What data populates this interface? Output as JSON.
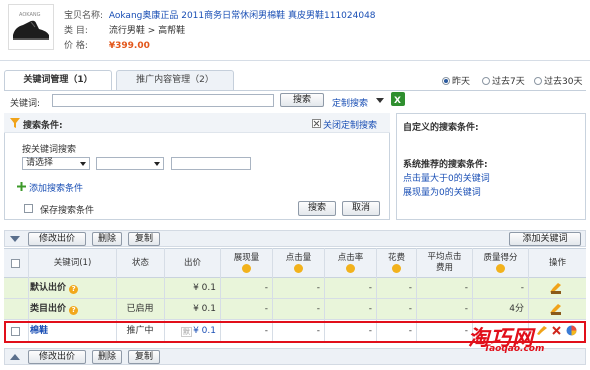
{
  "product": {
    "title_label": "宝贝名称:",
    "title": "Aokang奥康正品 2011商务日常休闲男棉鞋 真皮男鞋111024048",
    "category_label": "类  目:",
    "category": "流行男鞋 > 高帮鞋",
    "price_label": "价  格:",
    "price": "¥399.00"
  },
  "tabs": [
    {
      "label": "关键词管理（1）",
      "active": true
    },
    {
      "label": "推广内容管理（2）",
      "active": false
    }
  ],
  "date_range": {
    "options": [
      "昨天",
      "过去7天",
      "过去30天"
    ],
    "selected": "昨天"
  },
  "keyword_bar": {
    "label": "关键词:",
    "input_value": "",
    "search_button": "搜索",
    "custom_search": "定制搜索"
  },
  "search_panel": {
    "title": "搜索条件:",
    "close_link": "关闭定制搜索",
    "by_keyword_label": "按关键词搜索",
    "select1_value": "请选择",
    "select2_value": "",
    "text_value": "",
    "add_condition": "添加搜索条件",
    "save_condition": "保存搜索条件",
    "search_button": "搜索",
    "cancel_button": "取消"
  },
  "custom_panel": {
    "title": "自定义的搜索条件:",
    "recommended_title": "系统推荐的搜索条件:",
    "links": [
      "点击量大于0的关键词",
      "展现量为0的关键词"
    ]
  },
  "action_bar": {
    "modify_bid": "修改出价",
    "delete": "删除",
    "copy": "复制",
    "add_keyword": "添加关键词"
  },
  "table": {
    "columns": [
      "关键词(1)",
      "状态",
      "出价",
      "展现量",
      "点击量",
      "点击率",
      "花费",
      "平均点击费用",
      "质量得分",
      "操作"
    ],
    "rows": [
      {
        "keyword": "默认出价",
        "status": "",
        "bid": "¥ 0.1",
        "impressions": "-",
        "clicks": "-",
        "ctr": "-",
        "cost": "-",
        "avg_cpc": "-",
        "quality": "-"
      },
      {
        "keyword": "类目出价",
        "status": "已启用",
        "bid": "¥ 0.1",
        "impressions": "-",
        "clicks": "-",
        "ctr": "-",
        "cost": "-",
        "avg_cpc": "-",
        "quality": "4分"
      },
      {
        "keyword": "棉鞋",
        "status": "推广中",
        "bid": "¥ 0.1",
        "impressions": "-",
        "clicks": "-",
        "ctr": "-",
        "cost": "-",
        "avg_cpc": "-",
        "quality": ""
      }
    ],
    "bid_tag": "默"
  },
  "watermark": {
    "cn": "淘巧网",
    "en": "Taoqao.com"
  }
}
